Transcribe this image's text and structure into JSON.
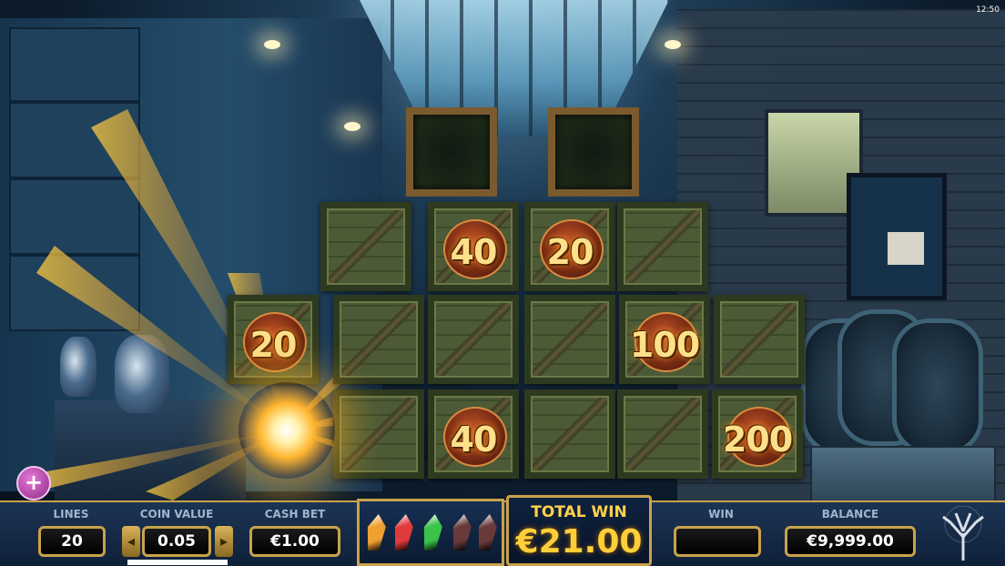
{
  "status": {
    "clock": "12:50"
  },
  "board": {
    "top_row": [
      {
        "state": "empty"
      },
      {
        "state": "empty"
      }
    ],
    "row2": [
      {
        "state": "closed"
      },
      {
        "state": "prize",
        "value": "40"
      },
      {
        "state": "prize",
        "value": "20"
      },
      {
        "state": "closed"
      }
    ],
    "row3": [
      {
        "state": "prize",
        "value": "20"
      },
      {
        "state": "closed"
      },
      {
        "state": "closed"
      },
      {
        "state": "closed"
      },
      {
        "state": "prize",
        "value": "100"
      },
      {
        "state": "closed"
      }
    ],
    "row4": [
      {
        "state": "burst"
      },
      {
        "state": "closed"
      },
      {
        "state": "prize",
        "value": "40"
      },
      {
        "state": "closed"
      },
      {
        "state": "closed"
      },
      {
        "state": "prize",
        "value": "200"
      }
    ]
  },
  "controls": {
    "plus_label": "+",
    "lines_label": "LINES",
    "lines_value": "20",
    "coin_value_label": "COIN VALUE",
    "coin_value": "0.05",
    "coin_decrease": "◂",
    "coin_increase": "▸",
    "cash_bet_label": "CASH BET",
    "cash_bet_value": "€1.00",
    "total_win_label": "TOTAL WIN",
    "total_win_value": "€21.00",
    "win_label": "WIN",
    "win_value": "",
    "balance_label": "BALANCE",
    "balance_value": "€9,999.00"
  },
  "gems": [
    {
      "name": "orange-gem",
      "color": "#f0a030"
    },
    {
      "name": "red-gem",
      "color": "#e03a3a"
    },
    {
      "name": "green-gem",
      "color": "#3ac24a"
    },
    {
      "name": "dark-gem",
      "color": "#6a3a3a"
    },
    {
      "name": "dark-gem",
      "color": "#6a3a3a"
    }
  ],
  "progress": 1.0,
  "colors": {
    "gold": "#c9a24a",
    "prize_text": "#ffe08a",
    "total_win": "#ffcf3a"
  }
}
